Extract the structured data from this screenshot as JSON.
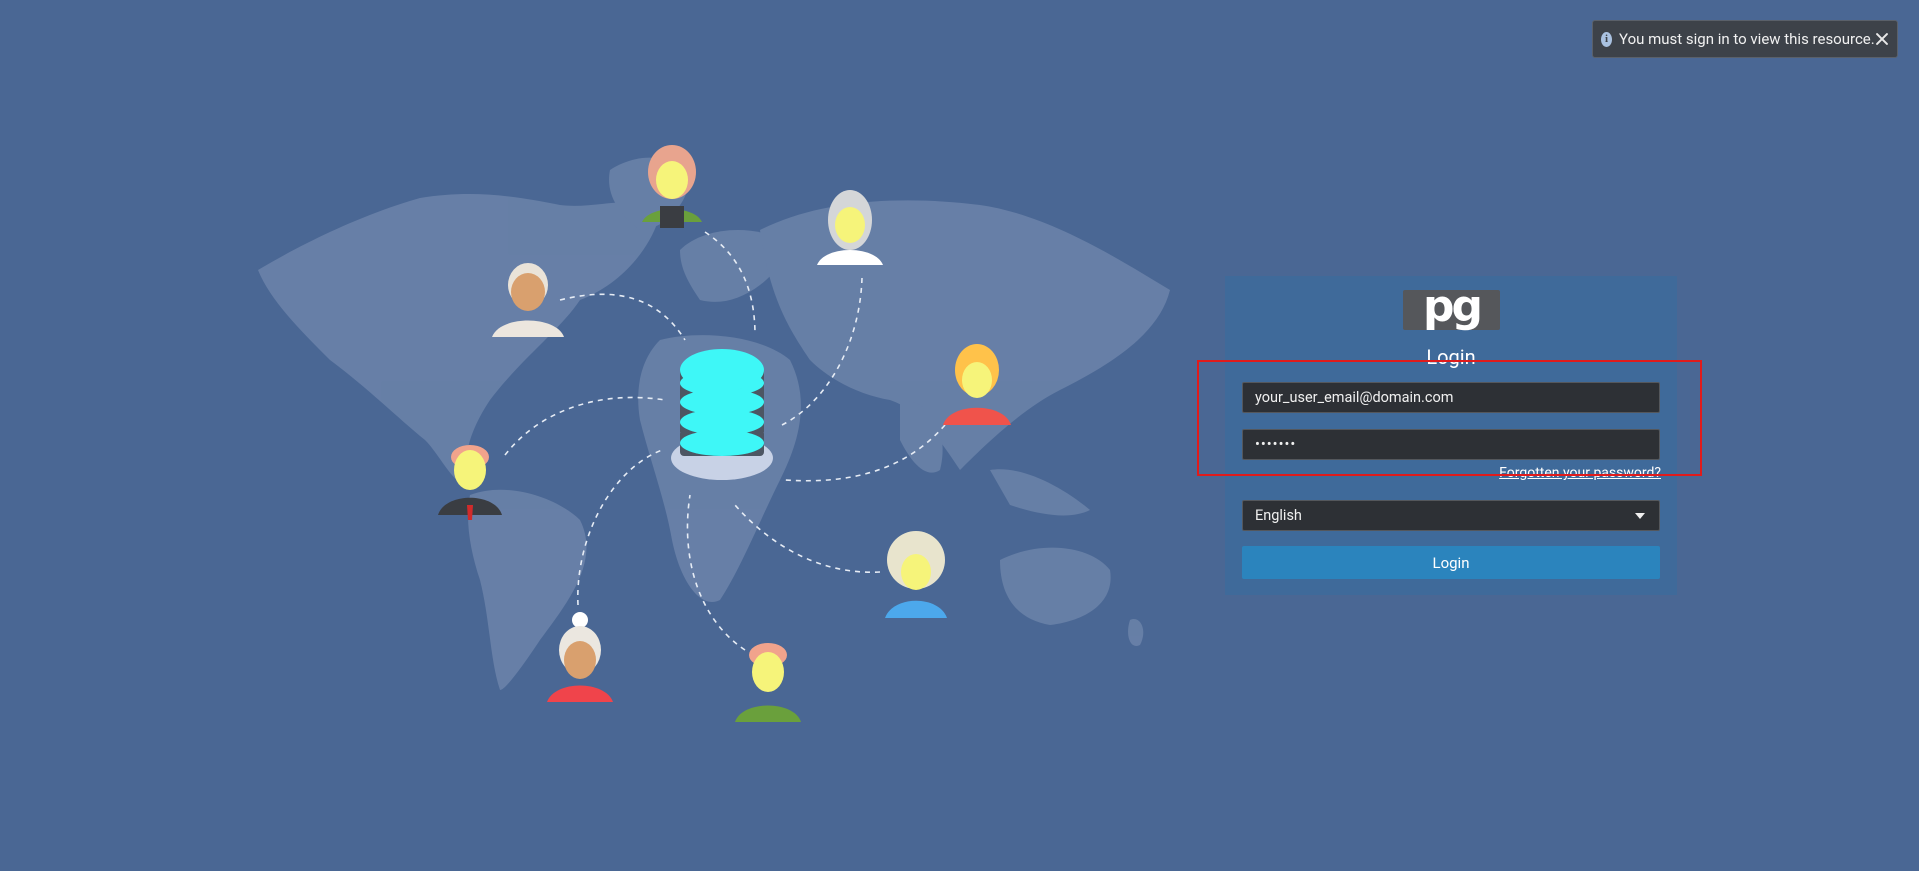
{
  "toast": {
    "icon": "info-icon",
    "message": "You must sign in to view this resource.",
    "close_icon": "close-icon"
  },
  "login": {
    "logo_text": "pg",
    "title": "Login",
    "email_value": "your_user_email@domain.com",
    "password_value": "•••••••",
    "forgot_password": "Forgotten your password?",
    "language": "English",
    "login_button": "Login"
  },
  "colors": {
    "background": "#4a6794",
    "panel": "#3f6a9a",
    "button": "#2b84bd",
    "database_accent": "#3ef7f7",
    "highlight": "#e01b1b"
  }
}
